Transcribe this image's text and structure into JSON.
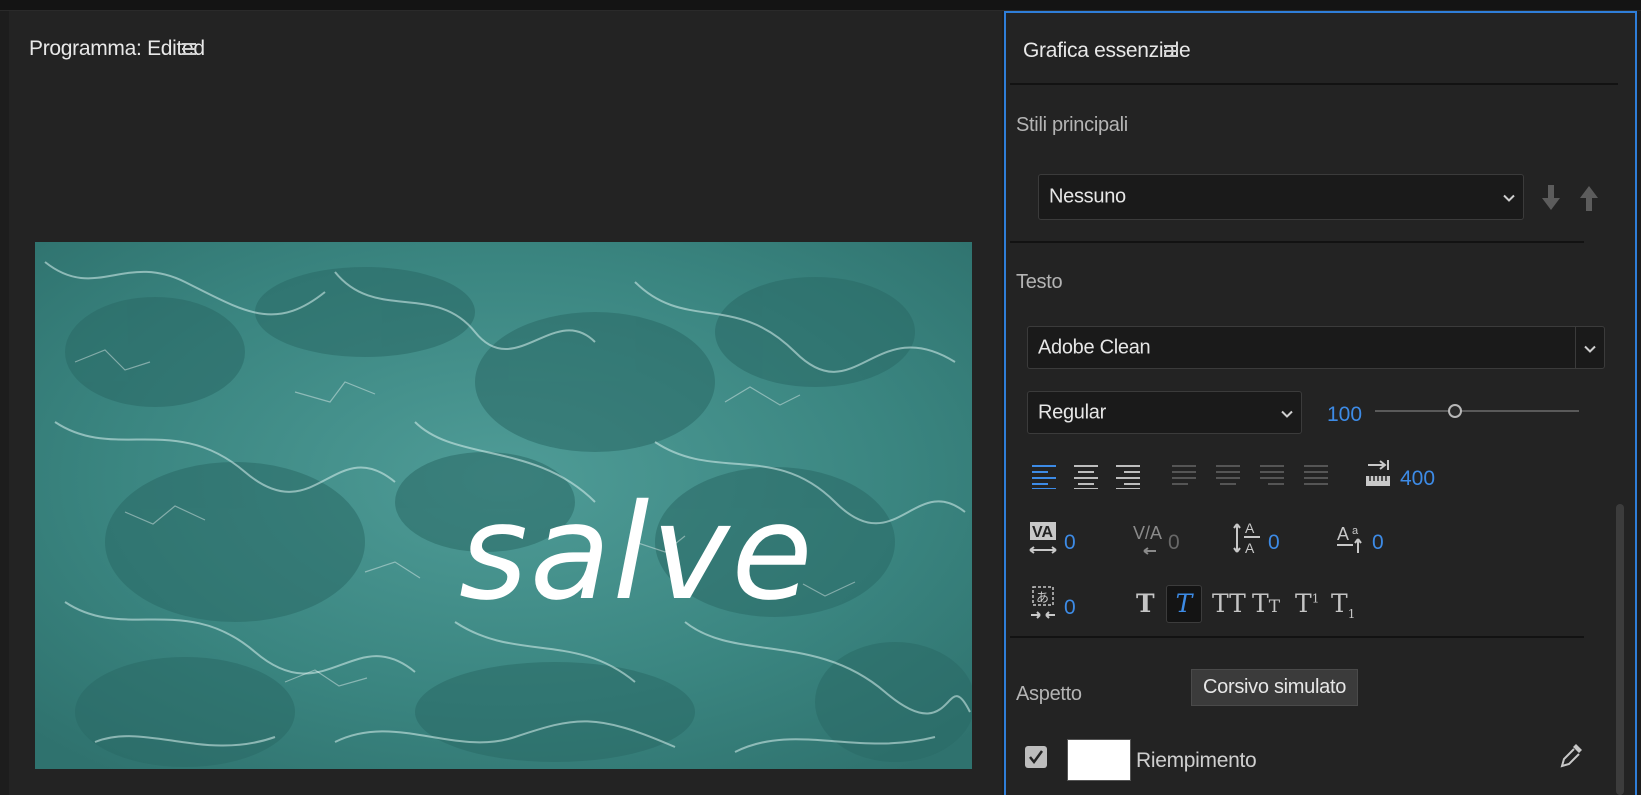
{
  "program_panel": {
    "title": "Programma: Edited",
    "menu_icon": "hamburger-menu-icon",
    "overlay_text": "salve"
  },
  "essential_graphics": {
    "title": "Grafica essenziale",
    "menu_icon": "hamburger-menu-icon",
    "master_styles": {
      "label": "Stili principali",
      "selected": "Nessuno"
    },
    "text": {
      "label": "Testo",
      "font": "Adobe Clean",
      "font_style": "Regular",
      "font_size": "100",
      "font_size_slider_fraction": 0.39,
      "tab_value": "400",
      "kerning": "0",
      "tracking": "0",
      "leading": "0",
      "baseline_shift": "0",
      "tsume": "0"
    },
    "tooltip": "Corsivo simulato",
    "appearance": {
      "label": "Aspetto",
      "fill_label": "Riempimento",
      "fill_color": "#ffffff",
      "fill_enabled": true
    }
  },
  "colors": {
    "accent": "#3d8be6",
    "panel_bg": "#232323",
    "panel_focus_border": "#2f7ed8"
  }
}
